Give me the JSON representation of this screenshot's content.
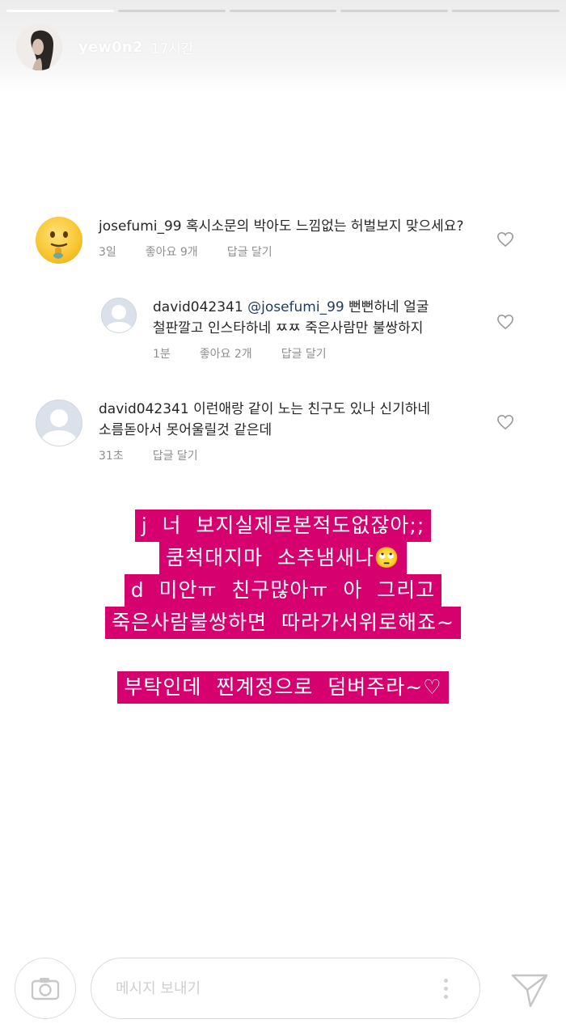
{
  "story": {
    "username": "yew0n2",
    "time": "17시간",
    "segments": [
      {
        "progress": 1
      },
      {
        "progress": 0
      },
      {
        "progress": 0
      },
      {
        "progress": 0
      },
      {
        "progress": 0
      }
    ]
  },
  "comments": [
    {
      "username": "josefumi_99",
      "text": "혹시소문의 박아도 느낌없는 허벌보지 맞으세요?",
      "time": "3일",
      "likes": "좋아요 9개",
      "reply_label": "답글 달기",
      "avatar": "emoji-avatar"
    },
    {
      "username": "david042341",
      "mention": "@josefumi_99",
      "text_line1": "뻔뻔하네 얼굴",
      "text_line2": "철판깔고 인스타하네 ㅉㅉ 죽은사람만 불쌍하지",
      "time": "1분",
      "likes": "좋아요 2개",
      "reply_label": "답글 달기",
      "avatar": "default-avatar"
    },
    {
      "username": "david042341",
      "text_line1": "이런애랑 같이 노는 친구도 있나 신기하네",
      "text_line2": "소름돋아서 못어울릴것 같은데",
      "time": "31초",
      "reply_label": "답글 달기",
      "avatar": "default-avatar"
    }
  ],
  "overlay": {
    "lines": [
      "j  너  보지실제로본적도없잖아;;",
      "쿰척대지마  소추냄새나",
      "d  미안ㅠ  친구많아ㅠ  아  그리고",
      "죽은사람불쌍하면  따라가서위로해죠~",
      "부탁인데  찐계정으로  덤벼주라~♡"
    ],
    "emoji": "🙄",
    "highlight_color": "#d6006f"
  },
  "footer": {
    "placeholder": "메시지 보내기",
    "camera_icon": "camera-icon",
    "send_icon": "send-icon",
    "more_icon": "more-options-icon"
  }
}
